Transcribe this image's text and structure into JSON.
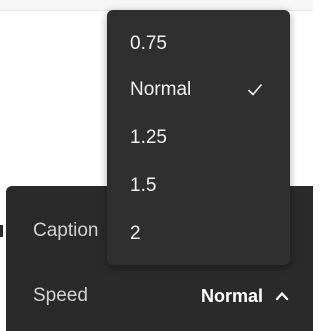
{
  "settings": {
    "captions_label": "Caption",
    "speed_label": "Speed",
    "speed_value": "Normal"
  },
  "speed_menu": {
    "options": [
      {
        "label": "0.75",
        "selected": false
      },
      {
        "label": "Normal",
        "selected": true
      },
      {
        "label": "1.25",
        "selected": false
      },
      {
        "label": "1.5",
        "selected": false
      },
      {
        "label": "2",
        "selected": false
      }
    ]
  },
  "colors": {
    "panel_bg": "#2a2a2a",
    "menu_bg": "#2f2f2f",
    "text": "#f2f2f2"
  }
}
